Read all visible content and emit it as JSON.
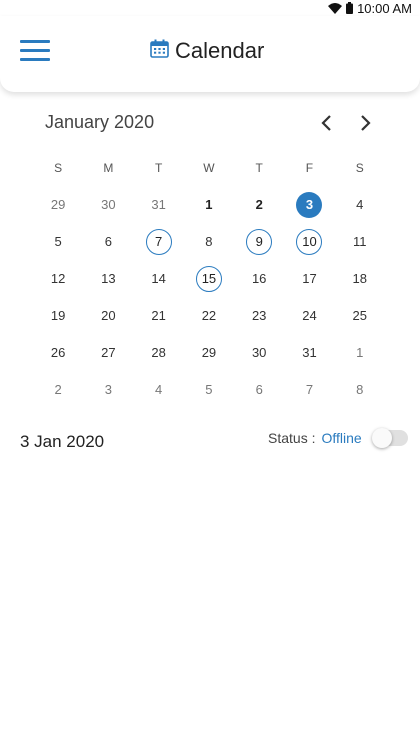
{
  "status_bar": {
    "time": "10:00 AM",
    "wifi_icon": "wifi-icon",
    "battery_icon": "battery-icon"
  },
  "app_bar": {
    "title": "Calendar",
    "menu_icon": "hamburger-menu-icon",
    "title_icon": "calendar-icon"
  },
  "calendar": {
    "month_label": "January 2020",
    "prev_icon": "chevron-left-icon",
    "next_icon": "chevron-right-icon",
    "weekdays": [
      "S",
      "M",
      "T",
      "W",
      "T",
      "F",
      "S"
    ],
    "weeks": [
      [
        {
          "day": "29",
          "state": "other"
        },
        {
          "day": "30",
          "state": "other"
        },
        {
          "day": "31",
          "state": "other"
        },
        {
          "day": "1",
          "state": "bold"
        },
        {
          "day": "2",
          "state": "bold"
        },
        {
          "day": "3",
          "state": "selected"
        },
        {
          "day": "4",
          "state": "current"
        }
      ],
      [
        {
          "day": "5",
          "state": "current"
        },
        {
          "day": "6",
          "state": "current"
        },
        {
          "day": "7",
          "state": "event"
        },
        {
          "day": "8",
          "state": "current"
        },
        {
          "day": "9",
          "state": "event"
        },
        {
          "day": "10",
          "state": "event"
        },
        {
          "day": "11",
          "state": "current"
        }
      ],
      [
        {
          "day": "12",
          "state": "current"
        },
        {
          "day": "13",
          "state": "current"
        },
        {
          "day": "14",
          "state": "current"
        },
        {
          "day": "15",
          "state": "event"
        },
        {
          "day": "16",
          "state": "current"
        },
        {
          "day": "17",
          "state": "current"
        },
        {
          "day": "18",
          "state": "current"
        }
      ],
      [
        {
          "day": "19",
          "state": "current"
        },
        {
          "day": "20",
          "state": "current"
        },
        {
          "day": "21",
          "state": "current"
        },
        {
          "day": "22",
          "state": "current"
        },
        {
          "day": "23",
          "state": "current"
        },
        {
          "day": "24",
          "state": "current"
        },
        {
          "day": "25",
          "state": "current"
        }
      ],
      [
        {
          "day": "26",
          "state": "current"
        },
        {
          "day": "27",
          "state": "current"
        },
        {
          "day": "28",
          "state": "current"
        },
        {
          "day": "29",
          "state": "current"
        },
        {
          "day": "30",
          "state": "current"
        },
        {
          "day": "31",
          "state": "current"
        },
        {
          "day": "1",
          "state": "other"
        }
      ],
      [
        {
          "day": "2",
          "state": "other"
        },
        {
          "day": "3",
          "state": "other"
        },
        {
          "day": "4",
          "state": "other"
        },
        {
          "day": "5",
          "state": "other"
        },
        {
          "day": "6",
          "state": "other"
        },
        {
          "day": "7",
          "state": "other"
        },
        {
          "day": "8",
          "state": "other"
        }
      ]
    ]
  },
  "selected_date": "3 Jan 2020",
  "status": {
    "label": "Status :",
    "value": "Offline",
    "toggle_on": false
  },
  "colors": {
    "accent": "#2a7bbf",
    "text": "#222222",
    "muted": "#777777"
  }
}
